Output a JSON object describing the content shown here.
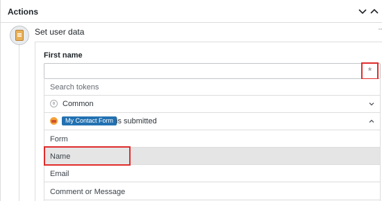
{
  "header": {
    "title": "Actions"
  },
  "step": {
    "title": "Set user data",
    "extra": "⇔"
  },
  "field": {
    "label": "First name",
    "value": "",
    "token_button_glyph": "*"
  },
  "tokens": {
    "search_placeholder": "Search tokens",
    "groups": [
      {
        "label": "Common",
        "expanded": false
      },
      {
        "badge": "My Contact Form",
        "suffix": "is submitted",
        "expanded": true
      }
    ],
    "items": [
      {
        "label": "Form",
        "highlighted": false
      },
      {
        "label": "Name",
        "highlighted": true
      },
      {
        "label": "Email",
        "highlighted": false
      },
      {
        "label": "Comment or Message",
        "highlighted": false
      }
    ]
  },
  "colors": {
    "highlight_box": "#e02b2b",
    "badge_bg": "#2271b1",
    "hover_row": "#e5e5e5"
  },
  "icons": [
    "chevron-down-icon",
    "chevron-up-icon",
    "form-step-icon",
    "asterisk-icon",
    "globe-icon",
    "form-plugin-icon"
  ]
}
